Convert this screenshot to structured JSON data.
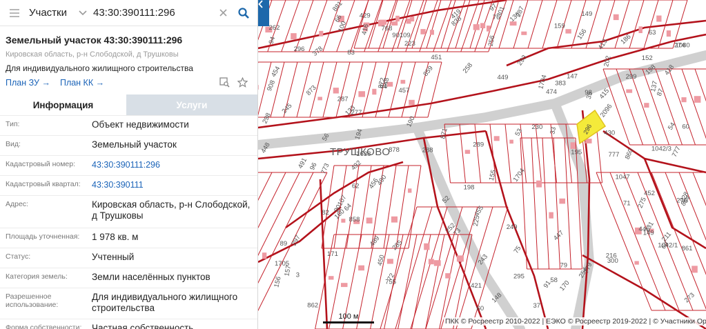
{
  "search": {
    "type_label": "Участки",
    "value": "43:30:390111:296"
  },
  "object": {
    "title": "Земельный участок 43:30:390111:296",
    "address_short": "Кировская область, р-н Слободской, д Трушковы",
    "purpose": "Для индивидуального жилищного строительства",
    "links": {
      "plan_zu": "План ЗУ",
      "plan_kk": "План КК"
    }
  },
  "tabs": {
    "info": "Информация",
    "services": "Услуги"
  },
  "fields": [
    {
      "key": "Тип:",
      "value": "Объект недвижимости"
    },
    {
      "key": "Вид:",
      "value": "Земельный участок"
    },
    {
      "key": "Кадастровый номер:",
      "value": "43:30:390111:296"
    },
    {
      "key": "Кадастровый квартал:",
      "value": "43:30:390111"
    },
    {
      "key": "Адрес:",
      "value": "Кировская область, р-н Слободской, д Трушковы"
    },
    {
      "key": "Площадь уточненная:",
      "value": "1 978 кв. м"
    },
    {
      "key": "Статус:",
      "value": "Учтенный"
    },
    {
      "key": "Категория земель:",
      "value": "Земли населённых пунктов"
    },
    {
      "key": "Разрешенное использование:",
      "value": "Для индивидуального жилищного строительства"
    },
    {
      "key": "Форма собственности:",
      "value": "Частная собственность"
    }
  ],
  "map": {
    "village_label": "ТРУШКОВО",
    "scale_label": "100 м",
    "copyright": "ПКК © Росреестр 2010-2022 | ЕЭКО © Росреестр 2019-2022 | © Участники OpenStreetMap",
    "highlight_parcel": "296",
    "parcel_labels": [
      "848",
      "860",
      "862",
      "861",
      "864",
      "2096",
      "1042/3",
      "378",
      "838",
      "37",
      "859",
      "1705",
      "1704",
      "1704",
      "872",
      "873",
      "421",
      "33",
      "858",
      "1638",
      "908",
      "871",
      "63",
      "202",
      "1042/1",
      "90109",
      "289",
      "76",
      "779",
      "773",
      "777",
      "777",
      "1047",
      "1080",
      "878",
      "768",
      "881",
      "198",
      "194",
      "195",
      "170",
      "156",
      "419",
      "216",
      "136",
      "298",
      "288",
      "97",
      "287",
      "296",
      "295",
      "297",
      "285",
      "293",
      "301",
      "299",
      "300",
      "171",
      "413",
      "452",
      "755",
      "149",
      "35",
      "133",
      "147",
      "53",
      "61",
      "223",
      "225",
      "60",
      "90107",
      "273",
      "274",
      "275",
      "276",
      "277",
      "230",
      "231",
      "228",
      "82",
      "489",
      "490",
      "491",
      "492",
      "79",
      "211",
      "190",
      "186",
      "149",
      "148",
      "416",
      "415",
      "474",
      "418",
      "429",
      "430",
      "446",
      "447",
      "448",
      "449",
      "450",
      "451",
      "454",
      "455",
      "456",
      "457",
      "152",
      "155",
      "156",
      "157",
      "159",
      "160",
      "198",
      "243",
      "245",
      "249",
      "254",
      "256",
      "258",
      "262",
      "252",
      "383",
      "287",
      "137",
      "72",
      "52",
      "54",
      "56",
      "58",
      "60",
      "62",
      "64",
      "66",
      "68",
      "83",
      "71",
      "73",
      "75",
      "87",
      "89",
      "91",
      "94",
      "96",
      "98",
      "100",
      "3"
    ]
  }
}
